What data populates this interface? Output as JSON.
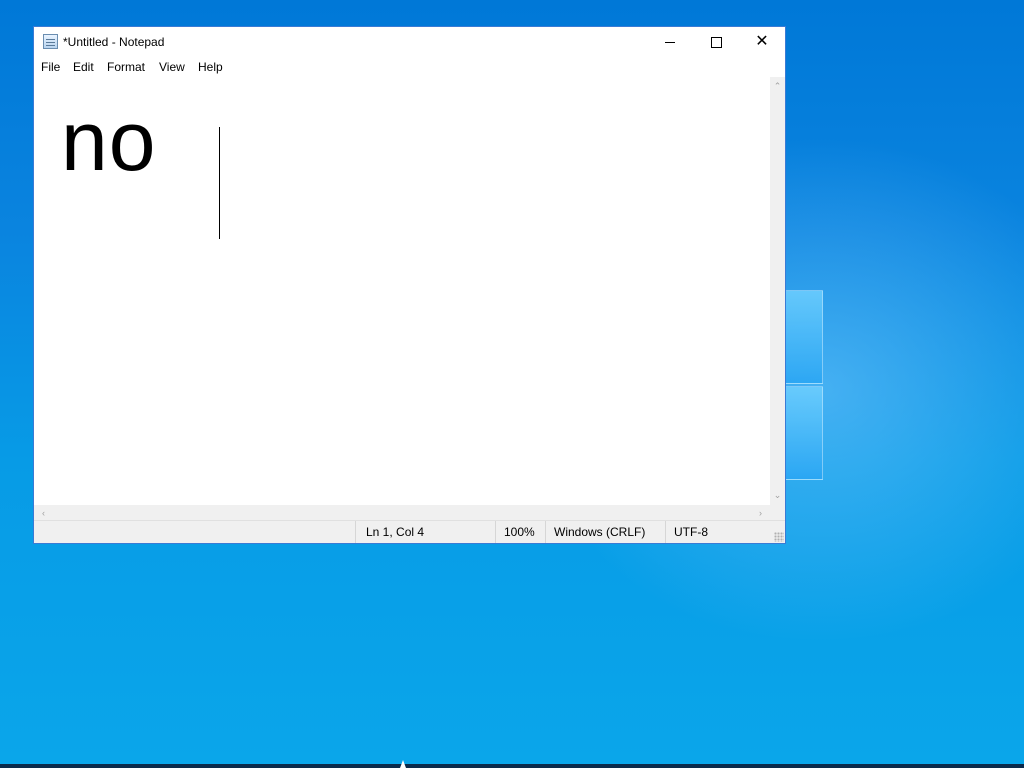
{
  "window": {
    "title": "*Untitled - Notepad"
  },
  "titlebar_buttons": {
    "minimize_icon": "minimize-icon",
    "maximize_icon": "maximize-icon",
    "close_icon": "close-icon",
    "close_glyph": "✕"
  },
  "menu": {
    "items": [
      {
        "label": "File"
      },
      {
        "label": "Edit"
      },
      {
        "label": "Format"
      },
      {
        "label": "View"
      },
      {
        "label": "Help"
      }
    ]
  },
  "editor": {
    "content": "no"
  },
  "scrollbars": {
    "up": "⌃",
    "down": "⌄",
    "left": "‹",
    "right": "›"
  },
  "status": {
    "position": "Ln 1, Col 4",
    "zoom": "100%",
    "line_ending": "Windows (CRLF)",
    "encoding": "UTF-8"
  },
  "colors": {
    "desktop_accent": "#0078d7",
    "window_border": "#3a7bd5"
  }
}
